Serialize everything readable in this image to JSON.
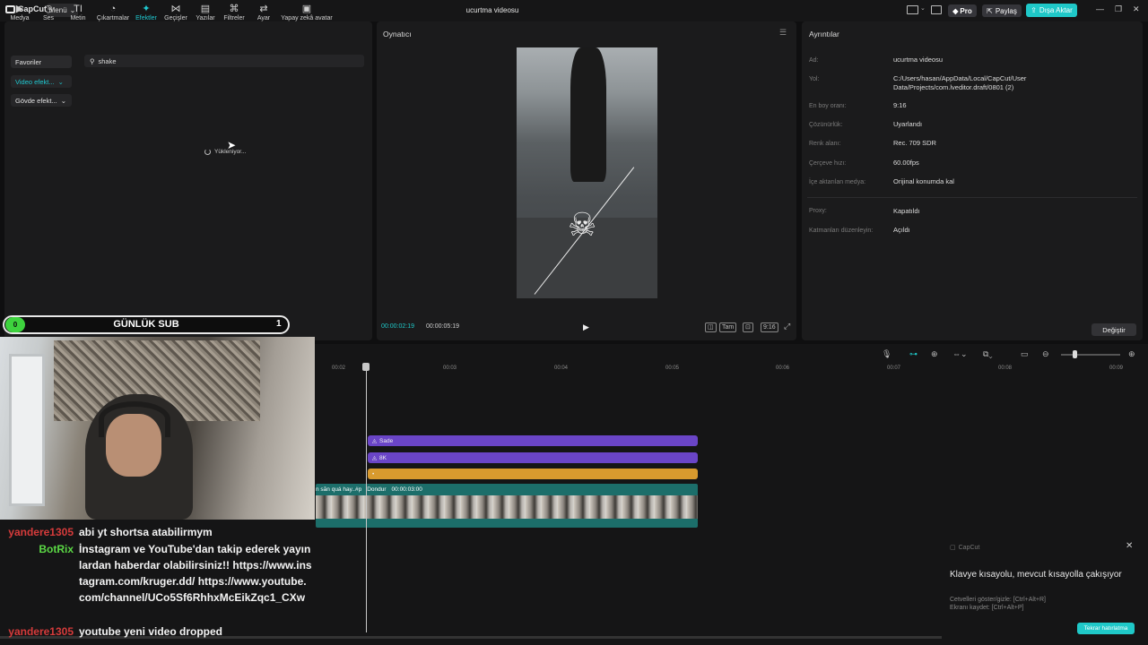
{
  "app": {
    "logo": "CapCut",
    "menu_label": "Menü",
    "project_title": "ucurtma videosu"
  },
  "titlebar": {
    "pro": "Pro",
    "share": "Paylaş",
    "export": "Dışa Aktar"
  },
  "toolbar": [
    {
      "label": "Medya",
      "icon": "▶"
    },
    {
      "label": "Ses",
      "icon": "◷"
    },
    {
      "label": "Metin",
      "icon": "TI"
    },
    {
      "label": "Çıkartmalar",
      "icon": "◔"
    },
    {
      "label": "Efektler",
      "icon": "✦"
    },
    {
      "label": "Geçişler",
      "icon": "⋈"
    },
    {
      "label": "Yazılar",
      "icon": "▤"
    },
    {
      "label": "Filtreler",
      "icon": "⌘"
    },
    {
      "label": "Ayar",
      "icon": "⇄"
    },
    {
      "label": "Yapay zekâ avatar",
      "icon": "▣"
    }
  ],
  "sidebar": {
    "favorites": "Favoriler",
    "video_effects": "Video efekt...",
    "body_effects": "Gövde efekt..."
  },
  "search": {
    "value": "shake",
    "loading": "Yükleniyor..."
  },
  "player": {
    "title": "Oynatıcı",
    "current_time": "00:00:02:19",
    "total_time": "00:00:05:19",
    "quality_label": "Tam",
    "ratio_label": "9:16"
  },
  "details": {
    "title": "Ayrıntılar",
    "rows": [
      {
        "label": "Ad:",
        "value": "ucurtma videosu"
      },
      {
        "label": "Yol:",
        "value": "C:/Users/hasan/AppData/Local/CapCut/User Data/Projects/com.lveditor.draft/0801 (2)"
      },
      {
        "label": "En boy oranı:",
        "value": "9:16"
      },
      {
        "label": "Çözünürlük:",
        "value": "Uyarlandı"
      },
      {
        "label": "Renk alanı:",
        "value": "Rec. 709 SDR"
      },
      {
        "label": "Çerçeve hızı:",
        "value": "60.00fps"
      },
      {
        "label": "İçe aktarılan medya:",
        "value": "Orijinal konumda kal"
      },
      {
        "label": "Proxy:",
        "value": "Kapatıldı"
      },
      {
        "label": "Katmanları düzenleyin:",
        "value": "Açıldı"
      }
    ],
    "change_button": "Değiştir"
  },
  "timeline": {
    "ticks": [
      "00:02",
      "00:03",
      "00:04",
      "00:05",
      "00:06",
      "00:07",
      "00:08",
      "00:09"
    ],
    "clips": [
      {
        "label": "Sade",
        "color": "#6a45c7"
      },
      {
        "label": "8K",
        "color": "#6a45c7"
      },
      {
        "label": "",
        "color": "#d89a2e"
      }
    ],
    "video_clip": {
      "name": "n săn quá hay..#p",
      "status": "Dondur",
      "duration": "00:00:03:00"
    }
  },
  "overlay": {
    "sub_label": "GÜNLÜK SUB",
    "sub_left": "0",
    "sub_right": "1"
  },
  "chat": [
    {
      "user": "yandere1305",
      "color": "#d63b3b",
      "message": "abi yt shortsa atabilirmym"
    },
    {
      "user": "BotRix",
      "color": "#5bd845",
      "message": "İnstagram ve YouTube'dan takip ederek yayınlardan haberdar olabilirsiniz!! https://www.instagram.com/kruger.dd/ https://www.youtube.com/channel/UCo5Sf6RhhxMcEikZqc1_CXw"
    },
    {
      "user": "yandere1305",
      "color": "#d63b3b",
      "message": "youtube yeni video dropped"
    }
  ],
  "toast": {
    "app": "CapCut",
    "title": "Klavye kısayolu, mevcut kısayolla çakışıyor",
    "line1": "Cetvelleri göster/gizle: [Ctrl+Alt+R]",
    "line2": "Ekranı kaydet: [Ctrl+Alt+P]",
    "button": "Tekrar hatırlatma"
  },
  "colors": {
    "accent": "#1fc8c8",
    "panel": "#1b1b1c"
  }
}
